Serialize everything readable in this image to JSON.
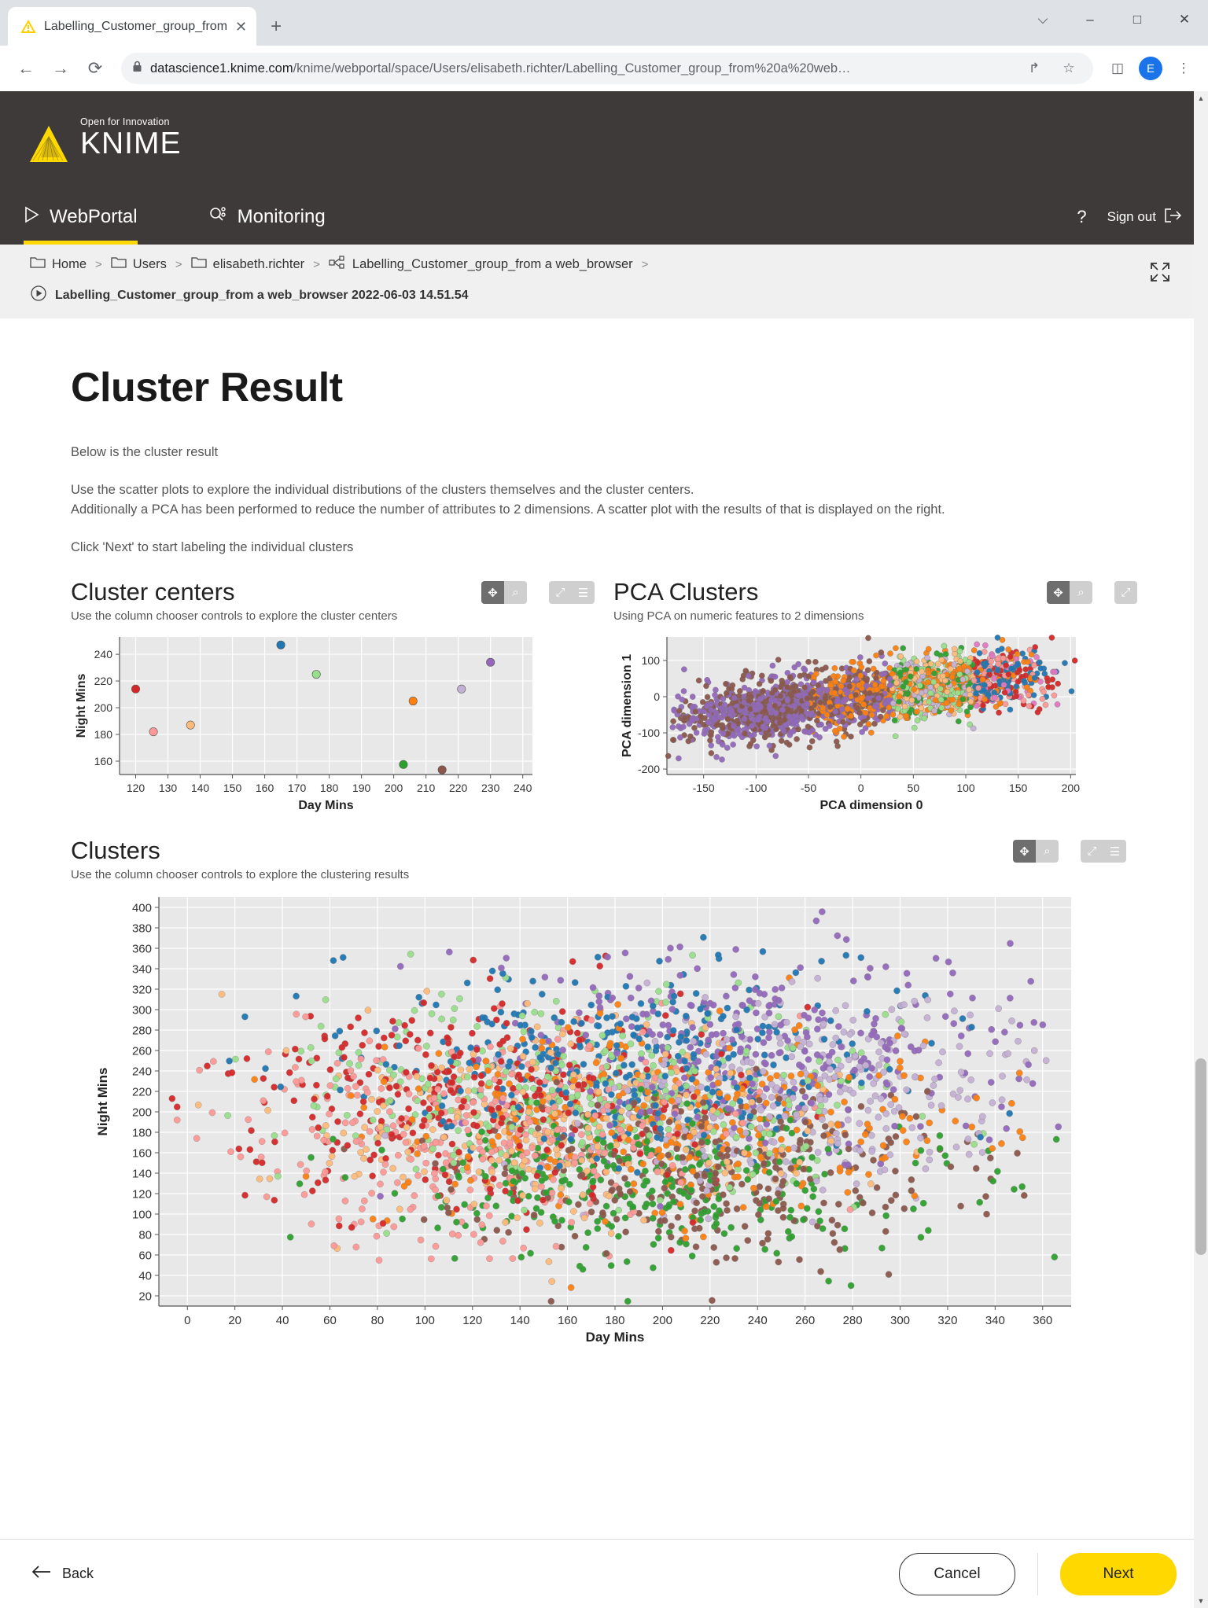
{
  "browser": {
    "tab": {
      "title": "Labelling_Customer_group_from",
      "favicon": "knime-warning-icon",
      "close": "✕"
    },
    "newtab_label": "+",
    "window_controls": {
      "chevron": "⌵",
      "minimize": "–",
      "maximize": "□",
      "close": "✕"
    },
    "nav": {
      "back": "←",
      "forward": "→",
      "reload": "⟳"
    },
    "url_host": "datascience1.knime.com",
    "url_path": "/knime/webportal/space/Users/elisabeth.richter/Labelling_Customer_group_from%20a%20web…",
    "lock_icon": "lock-icon",
    "actions": {
      "share": "↱",
      "bookmark": "☆",
      "sidepanel": "◫",
      "menu": "⋮"
    },
    "profile_initial": "E"
  },
  "knime": {
    "logo_slogan": "Open for Innovation",
    "logo_name": "KNIME",
    "nav_items": [
      {
        "label": "WebPortal",
        "icon": "play-triangle-icon",
        "active": true
      },
      {
        "label": "Monitoring",
        "icon": "monitoring-icon",
        "active": false
      }
    ],
    "help_label": "?",
    "signout_label": "Sign out",
    "expand_icon": "expand-fullscreen-icon"
  },
  "breadcrumb": {
    "items": [
      "Home",
      "Users",
      "elisabeth.richter",
      "Labelling_Customer_group_from a web_browser"
    ],
    "separator": ">",
    "trailing_separator": ">"
  },
  "job": {
    "icon": "job-play-icon",
    "label": "Labelling_Customer_group_from a web_browser 2022-06-03 14.51.54"
  },
  "page": {
    "title": "Cluster Result",
    "paragraphs": [
      "Below is the cluster result",
      "Use the scatter plots to explore the individual distributions of the clusters themselves and the cluster centers.\nAdditionally a PCA has been performed to reduce the number of attributes to 2 dimensions. A scatter plot with the results of that is displayed on the right.",
      "Click 'Next' to start labeling the individual clusters"
    ]
  },
  "cards": {
    "cluster_centers": {
      "title": "Cluster centers",
      "subtitle": "Use the column chooser controls to explore the cluster centers",
      "controls": [
        {
          "name": "move-tool",
          "glyph": "✥",
          "state": "dark"
        },
        {
          "name": "zoom-tool",
          "glyph": "⌕",
          "state": "light"
        },
        {
          "name": "reset-tool",
          "glyph": "⤢",
          "state": "light"
        },
        {
          "name": "menu-tool",
          "glyph": "☰",
          "state": "light"
        }
      ]
    },
    "pca_clusters": {
      "title": "PCA Clusters",
      "subtitle": "Using PCA on numeric features to 2 dimensions",
      "controls": [
        {
          "name": "move-tool",
          "glyph": "✥",
          "state": "dark"
        },
        {
          "name": "zoom-tool",
          "glyph": "⌕",
          "state": "light"
        },
        {
          "name": "reset-tool",
          "glyph": "⤢",
          "state": "light"
        }
      ]
    },
    "clusters": {
      "title": "Clusters",
      "subtitle": "Use the column chooser controls to explore the clustering results",
      "controls": [
        {
          "name": "move-tool",
          "glyph": "✥",
          "state": "dark"
        },
        {
          "name": "zoom-tool",
          "glyph": "⌕",
          "state": "light"
        },
        {
          "name": "reset-tool",
          "glyph": "⤢",
          "state": "light"
        },
        {
          "name": "menu-tool",
          "glyph": "☰",
          "state": "light"
        }
      ]
    }
  },
  "footer": {
    "back_label": "Back",
    "back_icon": "arrow-left-icon",
    "cancel_label": "Cancel",
    "next_label": "Next"
  },
  "palette": {
    "knime_yellow": "#ffd800",
    "knime_dark": "#3e3a39",
    "plot_bg": "#e8e8e8",
    "cluster_colors": [
      "#1f77b4",
      "#ff7f0e",
      "#2ca02c",
      "#d62728",
      "#9467bd",
      "#8c564b",
      "#e377c2",
      "#7f7f7f",
      "#bcbd22",
      "#17becf",
      "#aec7e8",
      "#ffbb78",
      "#98df8a",
      "#ff9896",
      "#c5b0d5"
    ]
  },
  "chart_data": [
    {
      "id": "cluster-centers",
      "type": "scatter",
      "title": "Cluster centers",
      "subtitle": "Use the column chooser controls to explore the cluster centers",
      "xlabel": "Day Mins",
      "ylabel": "Night Mins",
      "xlim": [
        115,
        243
      ],
      "ylim": [
        150,
        253
      ],
      "xticks": [
        120,
        130,
        140,
        150,
        160,
        170,
        180,
        190,
        200,
        210,
        220,
        230,
        240
      ],
      "yticks": [
        160,
        180,
        200,
        220,
        240
      ],
      "grid": true,
      "legend": "none",
      "points": [
        {
          "x": 165.0,
          "y": 247.0,
          "color": "#1f77b4"
        },
        {
          "x": 230.0,
          "y": 234.0,
          "color": "#9467bd"
        },
        {
          "x": 176.0,
          "y": 225.0,
          "color": "#98df8a"
        },
        {
          "x": 120.0,
          "y": 214.0,
          "color": "#d62728"
        },
        {
          "x": 221.0,
          "y": 214.0,
          "color": "#c5b0d5"
        },
        {
          "x": 206.0,
          "y": 205.0,
          "color": "#ff7f0e"
        },
        {
          "x": 125.5,
          "y": 182.0,
          "color": "#ff9896"
        },
        {
          "x": 137.0,
          "y": 187.0,
          "color": "#ffbb78"
        },
        {
          "x": 203.0,
          "y": 157.5,
          "color": "#2ca02c"
        },
        {
          "x": 215.0,
          "y": 153.5,
          "color": "#8c564b"
        }
      ]
    },
    {
      "id": "pca-clusters",
      "type": "scatter",
      "title": "PCA Clusters",
      "subtitle": "Using PCA on numeric features to 2 dimensions",
      "xlabel": "PCA dimension 0",
      "ylabel": "PCA dimension 1",
      "xlim": [
        -185,
        205
      ],
      "ylim": [
        -215,
        165
      ],
      "xticks": [
        -150,
        -100,
        -50,
        0,
        50,
        100,
        150,
        200
      ],
      "yticks": [
        -200,
        -100,
        0,
        100
      ],
      "grid": true,
      "legend": "none",
      "n_points": 2200,
      "description": "Dense elongated cloud of ~2200 points sloping upward from lower-left to upper-right; colors follow the 10 cluster palette with purple/brown concentrated low-left, orange/pink/red toward upper-right."
    },
    {
      "id": "clusters",
      "type": "scatter",
      "title": "Clusters",
      "subtitle": "Use the column chooser controls to explore the clustering results",
      "xlabel": "Day Mins",
      "ylabel": "Night Mins",
      "xlim": [
        -12,
        372
      ],
      "ylim": [
        10,
        410
      ],
      "xticks": [
        0,
        20,
        40,
        60,
        80,
        100,
        120,
        140,
        160,
        180,
        200,
        220,
        240,
        260,
        280,
        300,
        320,
        340,
        360
      ],
      "yticks": [
        20,
        40,
        60,
        80,
        100,
        120,
        140,
        160,
        180,
        200,
        220,
        240,
        260,
        280,
        300,
        320,
        340,
        360,
        380,
        400
      ],
      "grid": true,
      "legend": "none",
      "n_points": 3300,
      "description": "Large round cloud of ~3300 customer records centered near Day Mins 180 / Night Mins 200; 10 colour-coded clusters intermixed, red/pink cluster left, blue and purple upper, green/brown/orange lower-right."
    }
  ]
}
